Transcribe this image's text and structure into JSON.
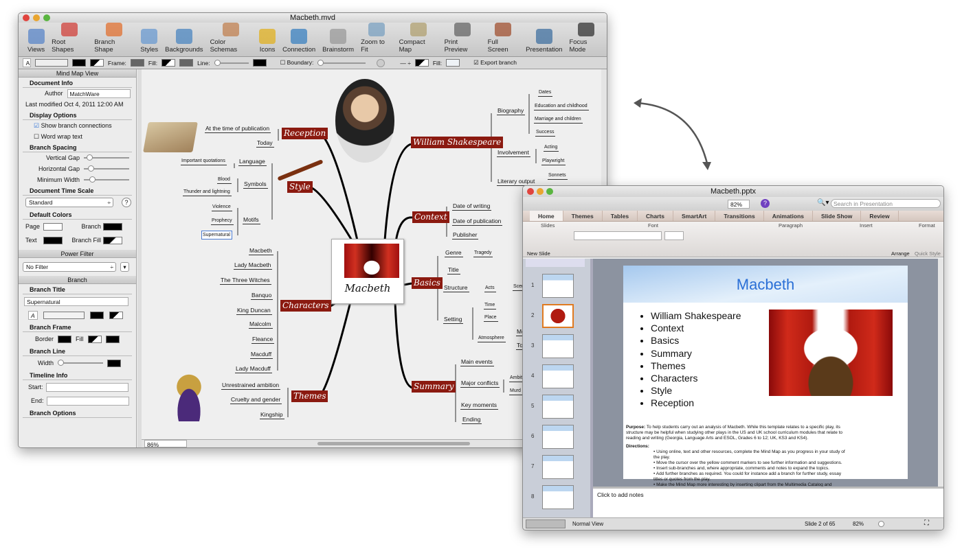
{
  "mindmap_window": {
    "title": "Macbeth.mvd",
    "toolbar": [
      "Views",
      "Root Shapes",
      "Branch Shape",
      "Styles",
      "Backgrounds",
      "Color Schemas",
      "Icons",
      "Connection",
      "Brainstorm",
      "Zoom to Fit",
      "Compact Map",
      "Print Preview",
      "Full Screen",
      "Presentation",
      "Focus Mode"
    ],
    "format_bar": {
      "text_btn": "A",
      "frame": "Frame:",
      "fill": "Fill:",
      "line": "Line:",
      "boundary": "Boundary:",
      "fill2": "Fill:",
      "export": "Export branch"
    },
    "panel": {
      "mind_map_view": "Mind Map View",
      "document_info": "Document Info",
      "author_label": "Author",
      "author": "MatchWare",
      "last_modified_label": "Last modified",
      "last_modified": "Oct 4, 2011 12:00 AM",
      "display_options": "Display Options",
      "show_connections": "Show branch connections",
      "word_wrap": "Word wrap text",
      "branch_spacing": "Branch Spacing",
      "vertical_gap": "Vertical Gap",
      "horizontal_gap": "Horizontal Gap",
      "minimum_width": "Minimum Width",
      "time_scale": "Document Time Scale",
      "time_scale_value": "Standard",
      "help": "?",
      "default_colors": "Default Colors",
      "page": "Page",
      "branch": "Branch",
      "text": "Text",
      "branch_fill": "Branch Fill",
      "power_filter": "Power Filter",
      "filter_value": "No Filter",
      "branch_header": "Branch",
      "branch_title": "Branch Title",
      "branch_title_value": "Supernatural",
      "branch_frame": "Branch Frame",
      "border": "Border",
      "fill": "Fill",
      "branch_line": "Branch Line",
      "width": "Width",
      "timeline_info": "Timeline Info",
      "start": "Start:",
      "end": "End:",
      "branch_options": "Branch Options"
    },
    "zoom": "86%",
    "map": {
      "center": "Macbeth",
      "main": [
        "Reception",
        "Style",
        "Characters",
        "Themes",
        "William Shakespeare",
        "Context",
        "Basics",
        "Summary"
      ],
      "reception": [
        "At the time of publication",
        "Today"
      ],
      "style": [
        "Language",
        "Important quotations",
        "Symbols",
        "Blood",
        "Thunder and lightning",
        "Motifs",
        "Violence",
        "Prophecy",
        "Supernatural"
      ],
      "characters": [
        "Macbeth",
        "Lady Macbeth",
        "The Three Witches",
        "Banquo",
        "King Duncan",
        "Malcolm",
        "Fleance",
        "Macduff",
        "Lady Macduff"
      ],
      "themes": [
        "Unrestrained ambition",
        "Cruelty and gender",
        "Kingship"
      ],
      "shakespeare": [
        "Biography",
        "Dates",
        "Education and childhood",
        "Marriage and children",
        "Success",
        "Involvement",
        "Acting",
        "Playwright",
        "Literary output",
        "Sonnets"
      ],
      "context": [
        "Date of writing",
        "Date of publication",
        "Publisher"
      ],
      "basics": [
        "Genre",
        "Tragedy",
        "Title",
        "Structure",
        "Acts",
        "Scenes",
        "Setting",
        "Time",
        "Place",
        "Atmosphere",
        "Mo",
        "To"
      ],
      "summary": [
        "Main events",
        "Major conflicts",
        "Ambit",
        "Murd",
        "Key moments",
        "Ending"
      ]
    }
  },
  "ppt_window": {
    "title": "Macbeth.pptx",
    "zoom": "82%",
    "search_placeholder": "Search in Presentation",
    "tabs": [
      "Home",
      "Themes",
      "Tables",
      "Charts",
      "SmartArt",
      "Transitions",
      "Animations",
      "Slide Show",
      "Review"
    ],
    "groups": [
      "Slides",
      "Font",
      "Paragraph",
      "Insert",
      "Format"
    ],
    "new_slide": "New Slide",
    "arrange": "Arrange",
    "quick_style": "Quick Style",
    "thumb_numbers": [
      "1",
      "2",
      "3",
      "4",
      "5",
      "6",
      "7",
      "8"
    ],
    "slide": {
      "title": "Macbeth",
      "bullets": [
        "William Shakespeare",
        "Context",
        "Basics",
        "Summary",
        "Themes",
        "Characters",
        "Style",
        "Reception"
      ],
      "purpose_label": "Purpose:",
      "purpose": "To help students carry out an analysis of Macbeth. While this template relates to a specific play, its structure may be helpful when studying other plays in the US and UK school curriculum modules that relate to reading and writing (Georgia, Language Arts and ESOL, Grades 6 to 12; UK, KS3 and KS4).",
      "directions_label": "Directions:",
      "directions": [
        "Using online, text and other resources, complete the Mind Map as you progress in your study of the play.",
        "Move the cursor over the yellow comment markers to see further information and suggestions.",
        "Insert sub-branches and, where appropriate, comments and notes to expand the topics.",
        "Add further branches as required. You could for instance add a branch for further study, essay titles or quotes from the play.",
        "Make the Mind Map more interesting by inserting clipart from the Multimedia Catalog and Internet images to illustrate Shakespeare's biography, the historical context and the main"
      ]
    },
    "notes_placeholder": "Click to add notes",
    "status": {
      "view": "Normal View",
      "slide": "Slide 2 of 65",
      "zoom": "82%"
    }
  },
  "colors": {
    "branch_red": "#8b1a10",
    "slide_title": "#2a6fd6"
  }
}
